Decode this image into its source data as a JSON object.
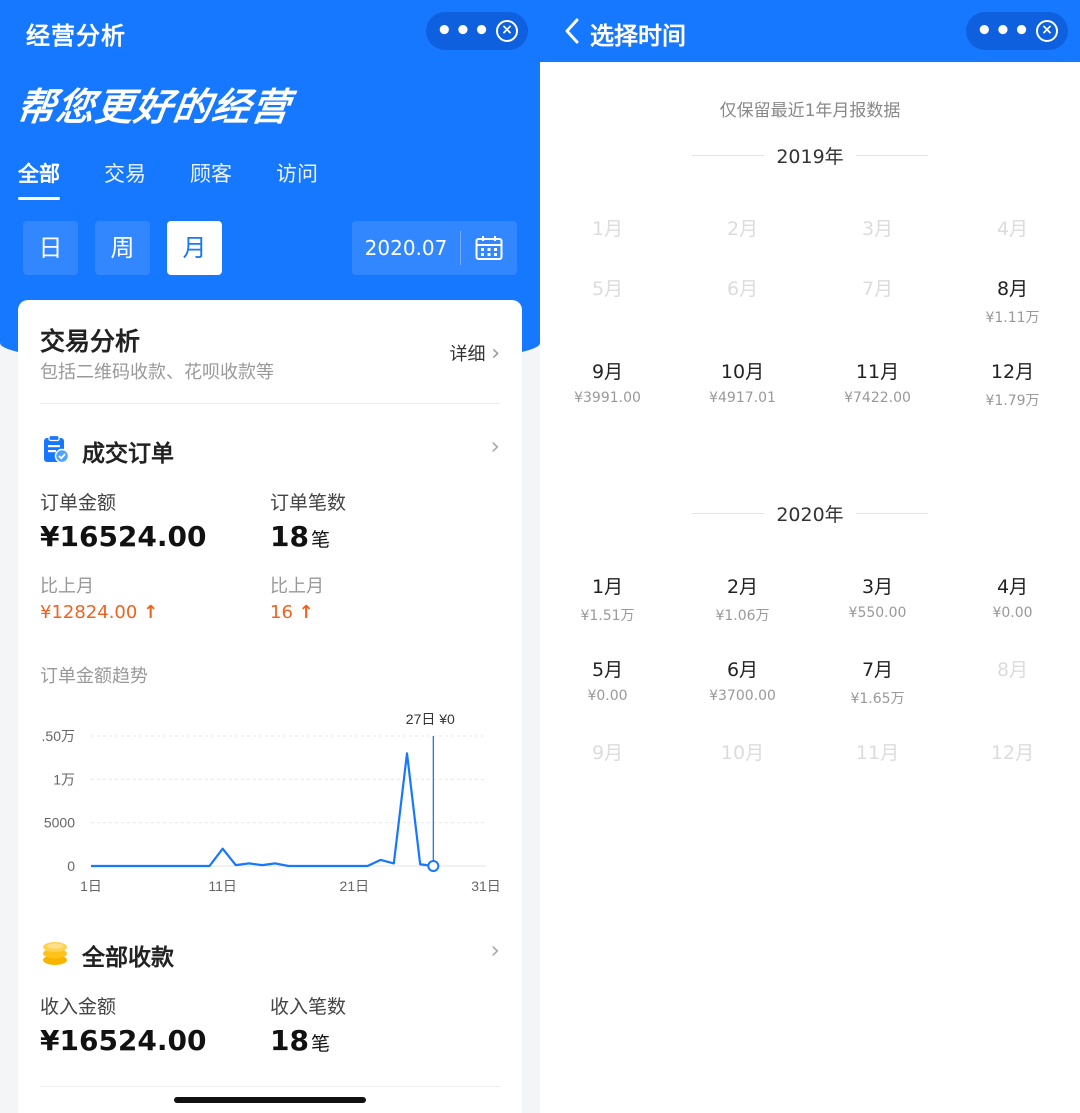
{
  "left": {
    "nav_title": "经营分析",
    "slogan": "帮您更好的经营",
    "tabs": [
      "全部",
      "交易",
      "顾客",
      "访问"
    ],
    "period": [
      "日",
      "周",
      "月"
    ],
    "date": "2020.07",
    "card": {
      "title": "交易分析",
      "subtitle": "包括二维码收款、花呗收款等",
      "detail": "详细",
      "orders": {
        "title": "成交订单",
        "amount_label": "订单金额",
        "amount_value": "¥16524.00",
        "count_label": "订单笔数",
        "count_value": "18",
        "count_unit": "笔",
        "cmp_amount_label": "比上月",
        "cmp_amount_value": "¥12824.00",
        "cmp_count_label": "比上月",
        "cmp_count_value": "16",
        "trend_title": "订单金额趋势"
      },
      "income": {
        "title": "全部收款",
        "amount_label": "收入金额",
        "amount_value": "¥16524.00",
        "count_label": "收入笔数",
        "count_value": "18",
        "count_unit": "笔"
      }
    }
  },
  "chart_data": {
    "type": "line",
    "title": "订单金额趋势",
    "x": [
      1,
      2,
      3,
      4,
      5,
      6,
      7,
      8,
      9,
      10,
      11,
      12,
      13,
      14,
      15,
      16,
      17,
      18,
      19,
      20,
      21,
      22,
      23,
      24,
      25,
      26,
      27
    ],
    "values": [
      0,
      0,
      0,
      0,
      0,
      0,
      0,
      0,
      0,
      0,
      2000,
      100,
      300,
      100,
      300,
      0,
      0,
      0,
      0,
      0,
      0,
      0,
      700,
      300,
      13000,
      200,
      0
    ],
    "xticks": [
      "1日",
      "11日",
      "21日",
      "31日"
    ],
    "yticks": [
      "0",
      "5000",
      "1万",
      ".50万"
    ],
    "ylim": [
      0,
      15000
    ],
    "tooltip": "27日 ¥0",
    "highlight_day": 27,
    "grid": true,
    "color": "#1677ff"
  },
  "right": {
    "title": "选择时间",
    "note": "仅保留最近1年月报数据",
    "years": [
      {
        "year": "2019年",
        "months": [
          {
            "m": "1月",
            "v": "",
            "enabled": false
          },
          {
            "m": "2月",
            "v": "",
            "enabled": false
          },
          {
            "m": "3月",
            "v": "",
            "enabled": false
          },
          {
            "m": "4月",
            "v": "",
            "enabled": false
          },
          {
            "m": "5月",
            "v": "",
            "enabled": false
          },
          {
            "m": "6月",
            "v": "",
            "enabled": false
          },
          {
            "m": "7月",
            "v": "",
            "enabled": false
          },
          {
            "m": "8月",
            "v": "¥1.11万",
            "enabled": true
          },
          {
            "m": "9月",
            "v": "¥3991.00",
            "enabled": true
          },
          {
            "m": "10月",
            "v": "¥4917.01",
            "enabled": true
          },
          {
            "m": "11月",
            "v": "¥7422.00",
            "enabled": true
          },
          {
            "m": "12月",
            "v": "¥1.79万",
            "enabled": true
          }
        ]
      },
      {
        "year": "2020年",
        "months": [
          {
            "m": "1月",
            "v": "¥1.51万",
            "enabled": true
          },
          {
            "m": "2月",
            "v": "¥1.06万",
            "enabled": true
          },
          {
            "m": "3月",
            "v": "¥550.00",
            "enabled": true
          },
          {
            "m": "4月",
            "v": "¥0.00",
            "enabled": true
          },
          {
            "m": "5月",
            "v": "¥0.00",
            "enabled": true
          },
          {
            "m": "6月",
            "v": "¥3700.00",
            "enabled": true
          },
          {
            "m": "7月",
            "v": "¥1.65万",
            "enabled": true
          },
          {
            "m": "8月",
            "v": "",
            "enabled": false
          },
          {
            "m": "9月",
            "v": "",
            "enabled": false
          },
          {
            "m": "10月",
            "v": "",
            "enabled": false
          },
          {
            "m": "11月",
            "v": "",
            "enabled": false
          },
          {
            "m": "12月",
            "v": "",
            "enabled": false
          }
        ]
      }
    ]
  },
  "colors": {
    "primary": "#1677ff",
    "up": "#f0621f"
  }
}
